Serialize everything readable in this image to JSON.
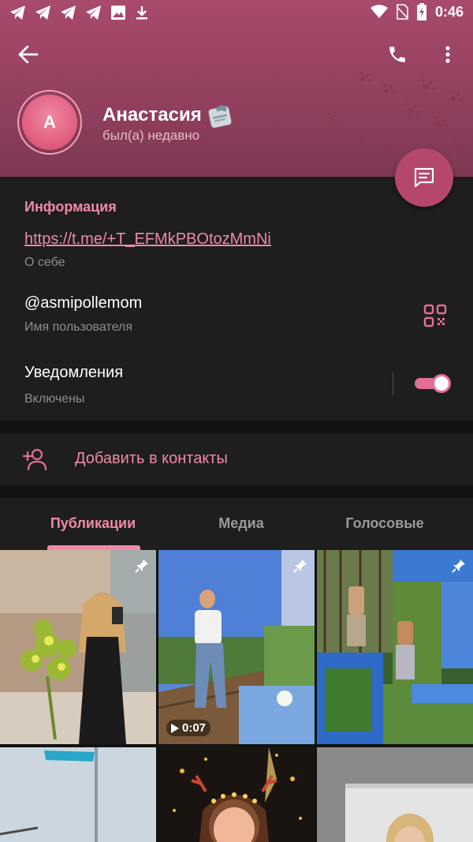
{
  "status_bar": {
    "time": "0:46",
    "left_icons": [
      "telegram-icon",
      "telegram-icon",
      "telegram-icon",
      "telegram-icon",
      "image-icon",
      "download-icon"
    ],
    "right_icons": [
      "wifi-icon",
      "no-sim-icon",
      "battery-charging-icon"
    ]
  },
  "profile": {
    "avatar_letter": "А",
    "name": "Анастасия",
    "status": "был(а) недавно",
    "accent": "#ef8aa6",
    "header_color": "#a84a6c"
  },
  "info": {
    "title": "Информация",
    "bio_link": "https://t.me/+T_EFMkPBOtozMmNi",
    "bio_label": "О себе",
    "username": "@asmipollemom",
    "username_label": "Имя пользователя",
    "notifications": "Уведомления",
    "notifications_state": "Включены",
    "notifications_enabled": true
  },
  "actions": {
    "add_contact": "Добавить в контакты"
  },
  "tabs": [
    {
      "label": "Публикации",
      "active": true
    },
    {
      "label": "Медиа",
      "active": false
    },
    {
      "label": "Голосовые",
      "active": false
    }
  ],
  "posts": [
    {
      "pinned": true,
      "duration": ""
    },
    {
      "pinned": true,
      "duration": "0:07"
    },
    {
      "pinned": true,
      "duration": ""
    },
    {
      "pinned": false,
      "duration": ""
    },
    {
      "pinned": false,
      "duration": ""
    },
    {
      "pinned": false,
      "duration": ""
    }
  ]
}
